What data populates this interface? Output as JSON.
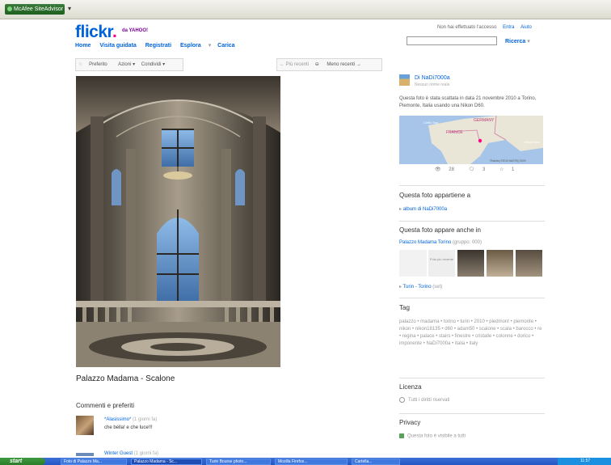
{
  "browser": {
    "mcafee_label": "McAfee SiteAdvisor",
    "dropdown": "▾"
  },
  "header": {
    "logo_main": "flickr",
    "logo_by": "da YAHOO!",
    "nav": [
      "Home",
      "Visita guidata",
      "Registrati",
      "Esplora",
      "Carica"
    ],
    "status": "Non hai effettuato l'accesso",
    "login": "Entra",
    "help": "Aiuto",
    "search_value": "",
    "search_button": "Ricerca"
  },
  "photo_toolbar": {
    "favorite": "Preferito",
    "actions": "Azioni ▾",
    "share": "Condividi ▾",
    "prev": "← Più recenti",
    "next": "Meno recenti →"
  },
  "photo": {
    "title": "Palazzo Madama - Scalone"
  },
  "comments": {
    "heading": "Commenti e preferiti",
    "items": [
      {
        "user": "*Alasissimo*",
        "ago": "(1 giorni fa)",
        "text": "che bella! e che luce!!!"
      },
      {
        "user": "Winter Guest",
        "ago": "(1 giorni fa)",
        "text": ""
      }
    ]
  },
  "owner": {
    "by": "Di",
    "name": "NaDi7000a",
    "sub": "Nessun nome reale"
  },
  "taken": "Questa foto è stata scattata in data 21 novembre 2010 a Torino, Piemonte, Italia usando una Nikon D60.",
  "map": {
    "labels": [
      "GERMANY",
      "FRANCE",
      "Celtic Sea",
      "Black Sea"
    ],
    "credit": "©Navteq ©2010 NAVTEQ 2009"
  },
  "stats": {
    "views": "28",
    "comments": "3",
    "faves": "1"
  },
  "belongs": {
    "heading": "Questa foto appartiene a",
    "album": "album di NaDi7000a"
  },
  "appears": {
    "heading": "Questa foto appare anche in",
    "group": "Palazzo Madama Torino",
    "group_meta": "(gruppo: 000)",
    "placeholder": "Foto più recente",
    "set": "Turin - Torino",
    "set_meta": "(set)"
  },
  "tags": {
    "heading": "Tag",
    "list": "palazzo • madama • torino • turin • 2010 • piedmont • piemonte • nikon • nikon18135 • d60 • adam50 • scalone • scala • barocco • re • regina • palace • stairs • finestre • cristalle • colonne • dorico • imponente • NaDi7000a • italia • italy"
  },
  "license": {
    "heading": "Licenza",
    "text": "Tutti i diritti riservati"
  },
  "privacy": {
    "heading": "Privacy",
    "text": "Questa foto è visibile a tutti"
  },
  "taskbar": {
    "start": "start",
    "tasks": [
      "Foto di Palazzo Ma...",
      "Palazzo Madama - Sc...",
      "Turin Bourse photo...",
      "Mozilla Firefox...",
      "Cartella..."
    ],
    "clock": "11:57"
  }
}
